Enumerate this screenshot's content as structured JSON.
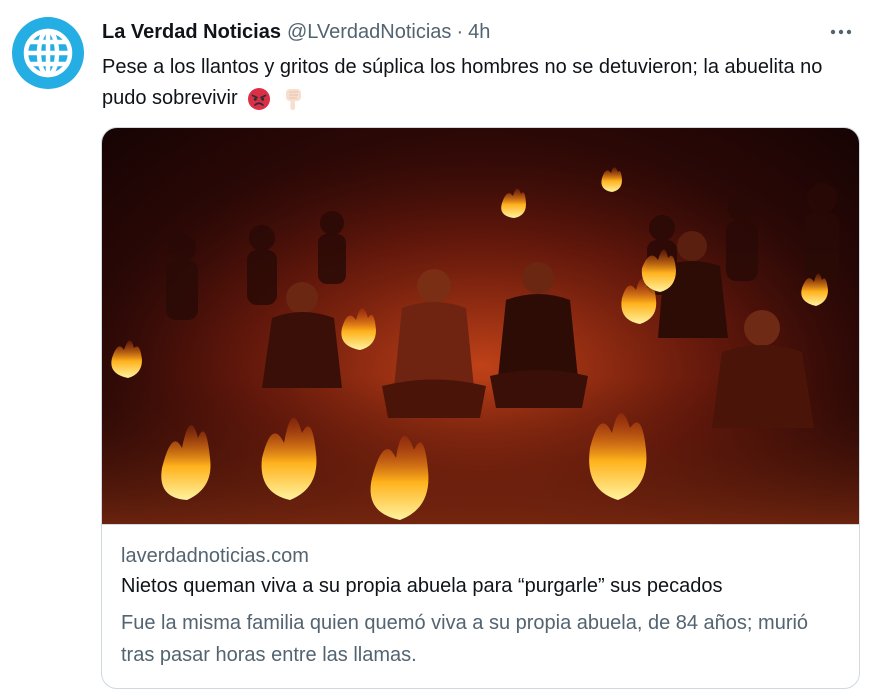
{
  "tweet": {
    "author_name": "La Verdad Noticias",
    "author_handle": "@LVerdadNoticias",
    "separator": "·",
    "time": "4h",
    "text": "Pese a los llantos y gritos de súplica los hombres no se detuvieron; la abuelita no pudo sobrevivir",
    "emojis": [
      "angry-face-emoji",
      "backhand-index-pointing-down-emoji"
    ]
  },
  "avatar": {
    "icon": "globe-icon",
    "color": "#25aee3"
  },
  "card": {
    "image_description_icon": "people-sitting-among-fire-image",
    "domain": "laverdadnoticias.com",
    "title": "Nietos queman viva a su propia abuela para “purgarle” sus pecados",
    "description": "Fue la misma familia quien quemó viva a su propia abuela, de 84 años; murió tras pasar horas entre las llamas."
  },
  "colors": {
    "text_primary": "#0f1419",
    "text_secondary": "#536471",
    "border": "#cfd9de"
  }
}
